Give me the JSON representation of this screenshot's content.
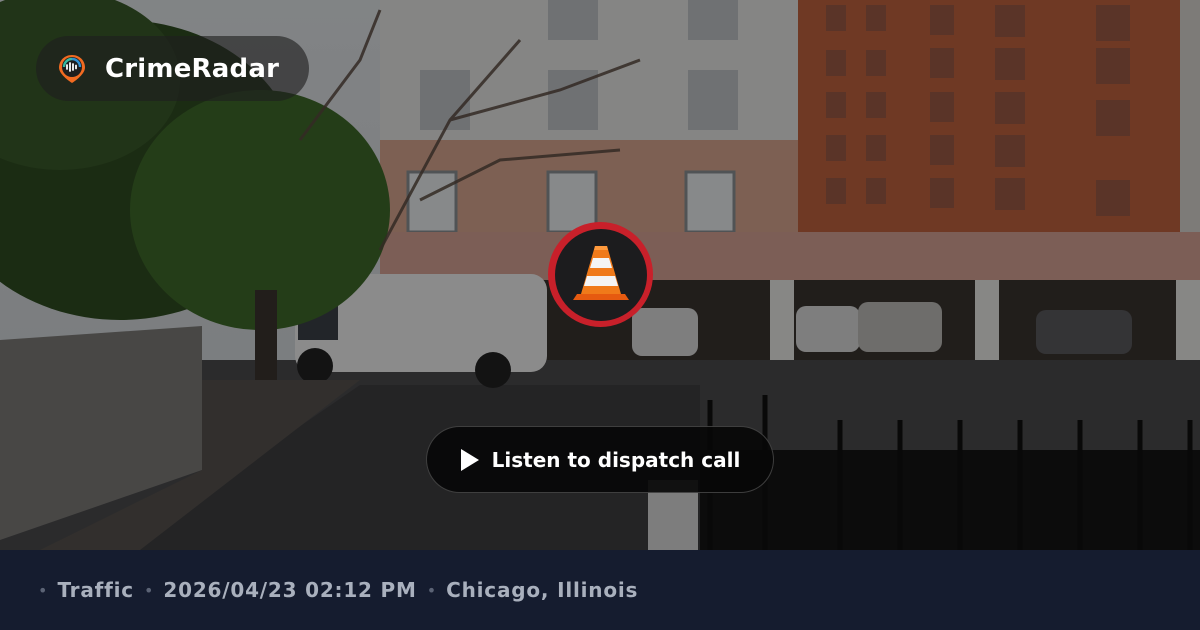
{
  "brand": {
    "name": "CrimeRadar",
    "logo_icon": "radar-pin-icon",
    "accent": "#f26b21"
  },
  "incident": {
    "category_icon": "traffic-cone-icon",
    "marker_color": "#c8202a"
  },
  "audio": {
    "button_label": "Listen to dispatch call",
    "button_icon": "play-icon"
  },
  "footer": {
    "separator": "•",
    "category": "Traffic",
    "datetime": "2026/04/23 02:12 PM",
    "location": "Chicago, Illinois",
    "background": "#151c2f"
  }
}
